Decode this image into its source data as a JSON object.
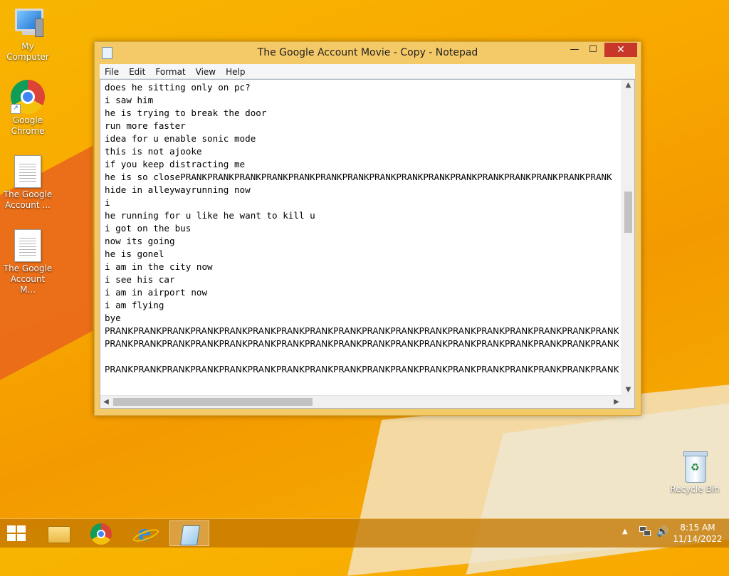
{
  "desktop": {
    "icons": [
      {
        "label": "My Computer"
      },
      {
        "label": "Google Chrome"
      },
      {
        "label": "The Google Account ..."
      },
      {
        "label": "The Google Account M..."
      },
      {
        "label": "Recycle Bin"
      }
    ]
  },
  "window": {
    "title": "The Google Account Movie - Copy - Notepad",
    "controls": {
      "minimize": "—",
      "maximize": "☐",
      "close": "✕"
    },
    "menu": [
      "File",
      "Edit",
      "Format",
      "View",
      "Help"
    ],
    "lines": [
      "does he sitting only on pc?",
      "i saw him",
      "he is trying to break the door",
      "run more faster",
      "idea for u enable sonic mode",
      "this is not ajooke",
      "if you keep distracting me",
      "he is so closePRANKPRANKPRANKPRANKPRANKPRANKPRANKPRANKPRANKPRANKPRANKPRANKPRANKPRANKPRANKPRANK",
      "hide in alleywayrunning now",
      "i",
      "he running for u like he want to kill u",
      "i got on the bus",
      "now its going",
      "he is gonel",
      "i am in the city now",
      "i see his car",
      "i am in airport now",
      "i am flying",
      "bye",
      "PRANKPRANKPRANKPRANKPRANKPRANKPRANKPRANKPRANKPRANKPRANKPRANKPRANKPRANKPRANKPRANKPRANKPRANK",
      "PRANKPRANKPRANKPRANKPRANKPRANKPRANKPRANKPRANKPRANKPRANKPRANKPRANKPRANKPRANKPRANKPRANKPRANK",
      "",
      "PRANKPRANKPRANKPRANKPRANKPRANKPRANKPRANKPRANKPRANKPRANKPRANKPRANKPRANKPRANKPRANKPRANKPRANK"
    ],
    "scroll_arrows": {
      "up": "▲",
      "down": "▼",
      "left": "◀",
      "right": "▶"
    }
  },
  "taskbar": {
    "clock_time": "8:15 AM",
    "clock_date": "11/14/2022",
    "tray_chevron": "▲",
    "volume_glyph": "🔊",
    "ie_glyph": "e",
    "apps": [
      "file-explorer",
      "google-chrome",
      "internet-explorer",
      "notepad"
    ]
  }
}
